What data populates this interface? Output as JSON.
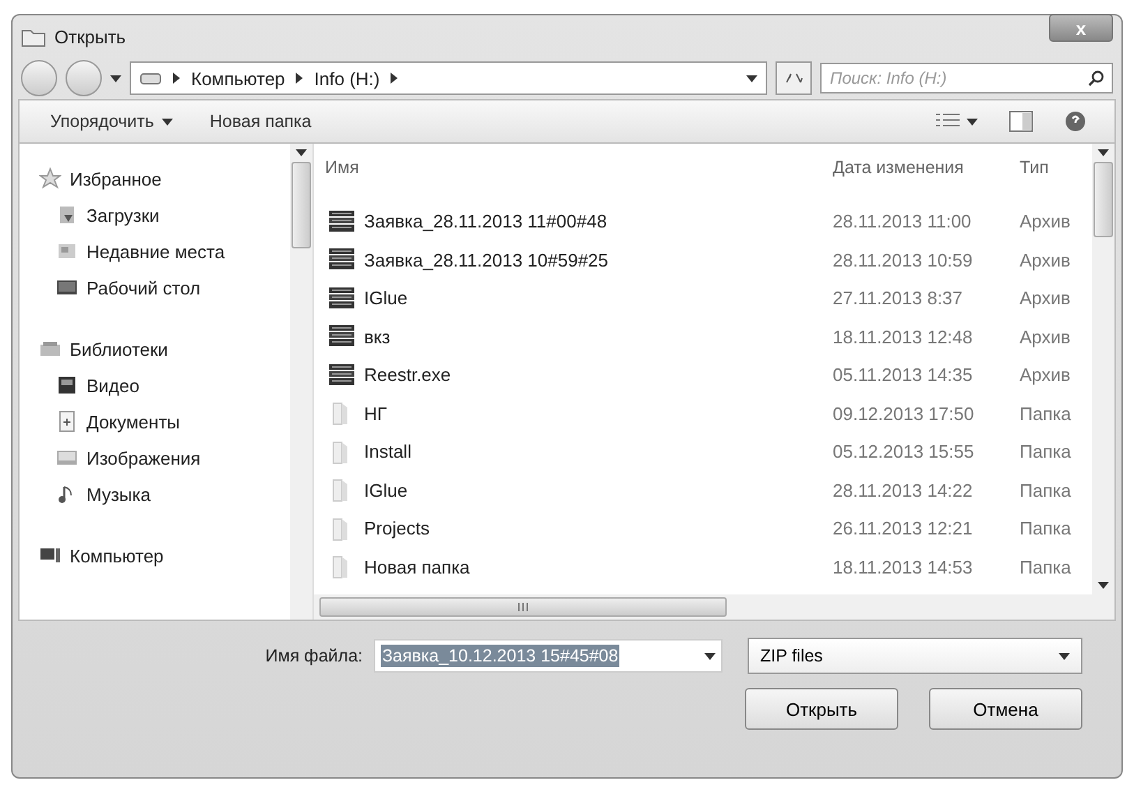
{
  "window": {
    "title": "Открыть",
    "close": "x"
  },
  "address": {
    "crumbs": [
      "Компьютер",
      "Info (H:)"
    ]
  },
  "search": {
    "placeholder": "Поиск: Info (H:)"
  },
  "toolbar": {
    "organize": "Упорядочить",
    "new_folder": "Новая папка"
  },
  "sidebar": {
    "groups": [
      {
        "label": "Избранное",
        "children": [
          {
            "label": "Загрузки"
          },
          {
            "label": "Недавние места"
          },
          {
            "label": "Рабочий стол"
          }
        ]
      },
      {
        "label": "Библиотеки",
        "children": [
          {
            "label": "Видео"
          },
          {
            "label": "Документы"
          },
          {
            "label": "Изображения"
          },
          {
            "label": "Музыка"
          }
        ]
      },
      {
        "label": "Компьютер"
      }
    ]
  },
  "table": {
    "columns": [
      "Имя",
      "Дата изменения",
      "Тип"
    ],
    "rows": [
      {
        "kind": "archive",
        "name": "Заявка_28.11.2013 11#00#48",
        "date": "28.11.2013 11:00",
        "type": "Архив"
      },
      {
        "kind": "archive",
        "name": "Заявка_28.11.2013 10#59#25",
        "date": "28.11.2013 10:59",
        "type": "Архив"
      },
      {
        "kind": "archive",
        "name": "IGlue",
        "date": "27.11.2013 8:37",
        "type": "Архив"
      },
      {
        "kind": "archive",
        "name": "вкз",
        "date": "18.11.2013 12:48",
        "type": "Архив"
      },
      {
        "kind": "archive",
        "name": "Reestr.exe",
        "date": "05.11.2013 14:35",
        "type": "Архив"
      },
      {
        "kind": "folder",
        "name": "НГ",
        "date": "09.12.2013 17:50",
        "type": "Папка"
      },
      {
        "kind": "folder",
        "name": "Install",
        "date": "05.12.2013 15:55",
        "type": "Папка"
      },
      {
        "kind": "folder",
        "name": "IGlue",
        "date": "28.11.2013 14:22",
        "type": "Папка"
      },
      {
        "kind": "folder",
        "name": "Projects",
        "date": "26.11.2013 12:21",
        "type": "Папка"
      },
      {
        "kind": "folder",
        "name": "Новая папка",
        "date": "18.11.2013 14:53",
        "type": "Папка"
      }
    ]
  },
  "filename": {
    "label": "Имя файла:",
    "value": "Заявка_10.12.2013 15#45#08",
    "selected": true
  },
  "filetype": {
    "value": "ZIP files"
  },
  "buttons": [
    "Открыть",
    "Отмена"
  ]
}
